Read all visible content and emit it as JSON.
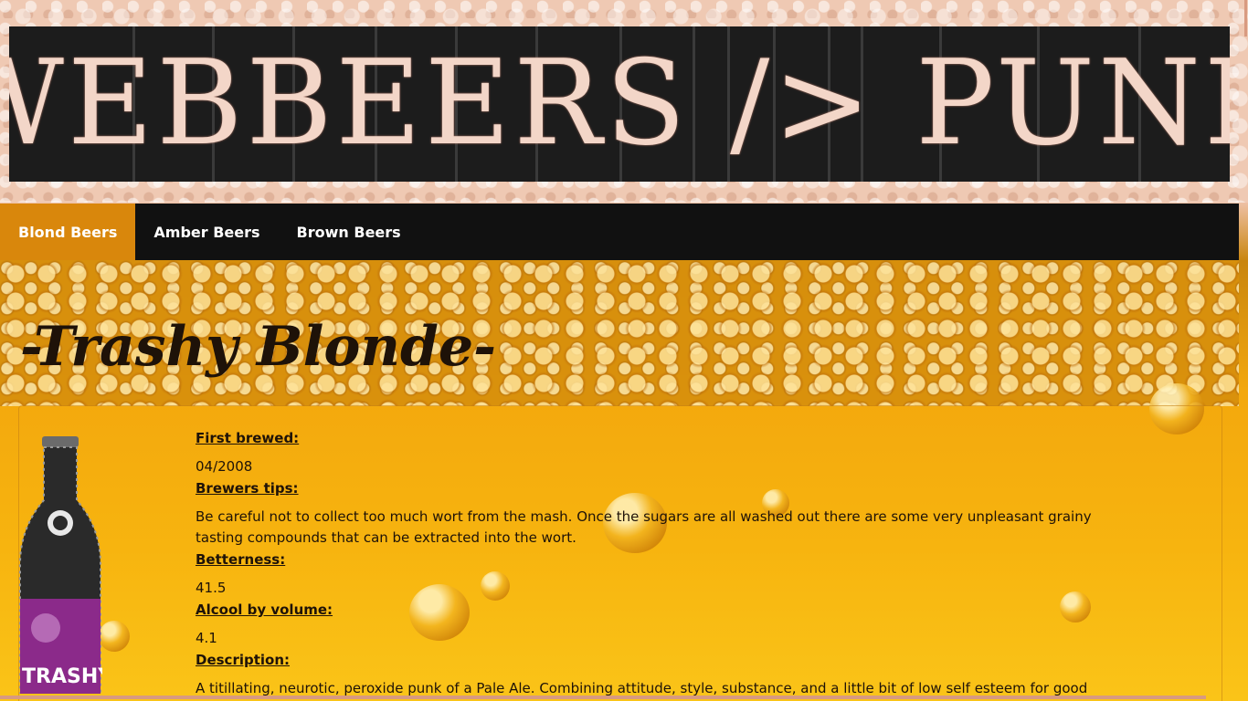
{
  "site": {
    "banner_text": "WEBBEERS /> PUNK"
  },
  "nav": {
    "items": [
      {
        "label": "Blond Beers",
        "active": true
      },
      {
        "label": "Amber Beers",
        "active": false
      },
      {
        "label": "Brown Beers",
        "active": false
      }
    ]
  },
  "beer": {
    "title": "-Trashy Blonde-",
    "bottle_label": "TRASHY",
    "fields": [
      {
        "label": "First brewed:",
        "value": "04/2008"
      },
      {
        "label": "Brewers tips:",
        "value": "Be careful not to collect too much wort from the mash. Once the sugars are all washed out there are some very unpleasant grainy tasting compounds that can be extracted into the wort."
      },
      {
        "label": "Betterness:",
        "value": "41.5"
      },
      {
        "label": "Alcool by volume:",
        "value": "4.1"
      },
      {
        "label": "Description:",
        "value": "A titillating, neurotic, peroxide punk of a Pale Ale. Combining attitude, style, substance, and a little bit of low self esteem for good"
      }
    ]
  },
  "colors": {
    "nav_active": "#d9870c",
    "nav_bg": "#111111",
    "banner_bg": "#1c1c1c"
  }
}
